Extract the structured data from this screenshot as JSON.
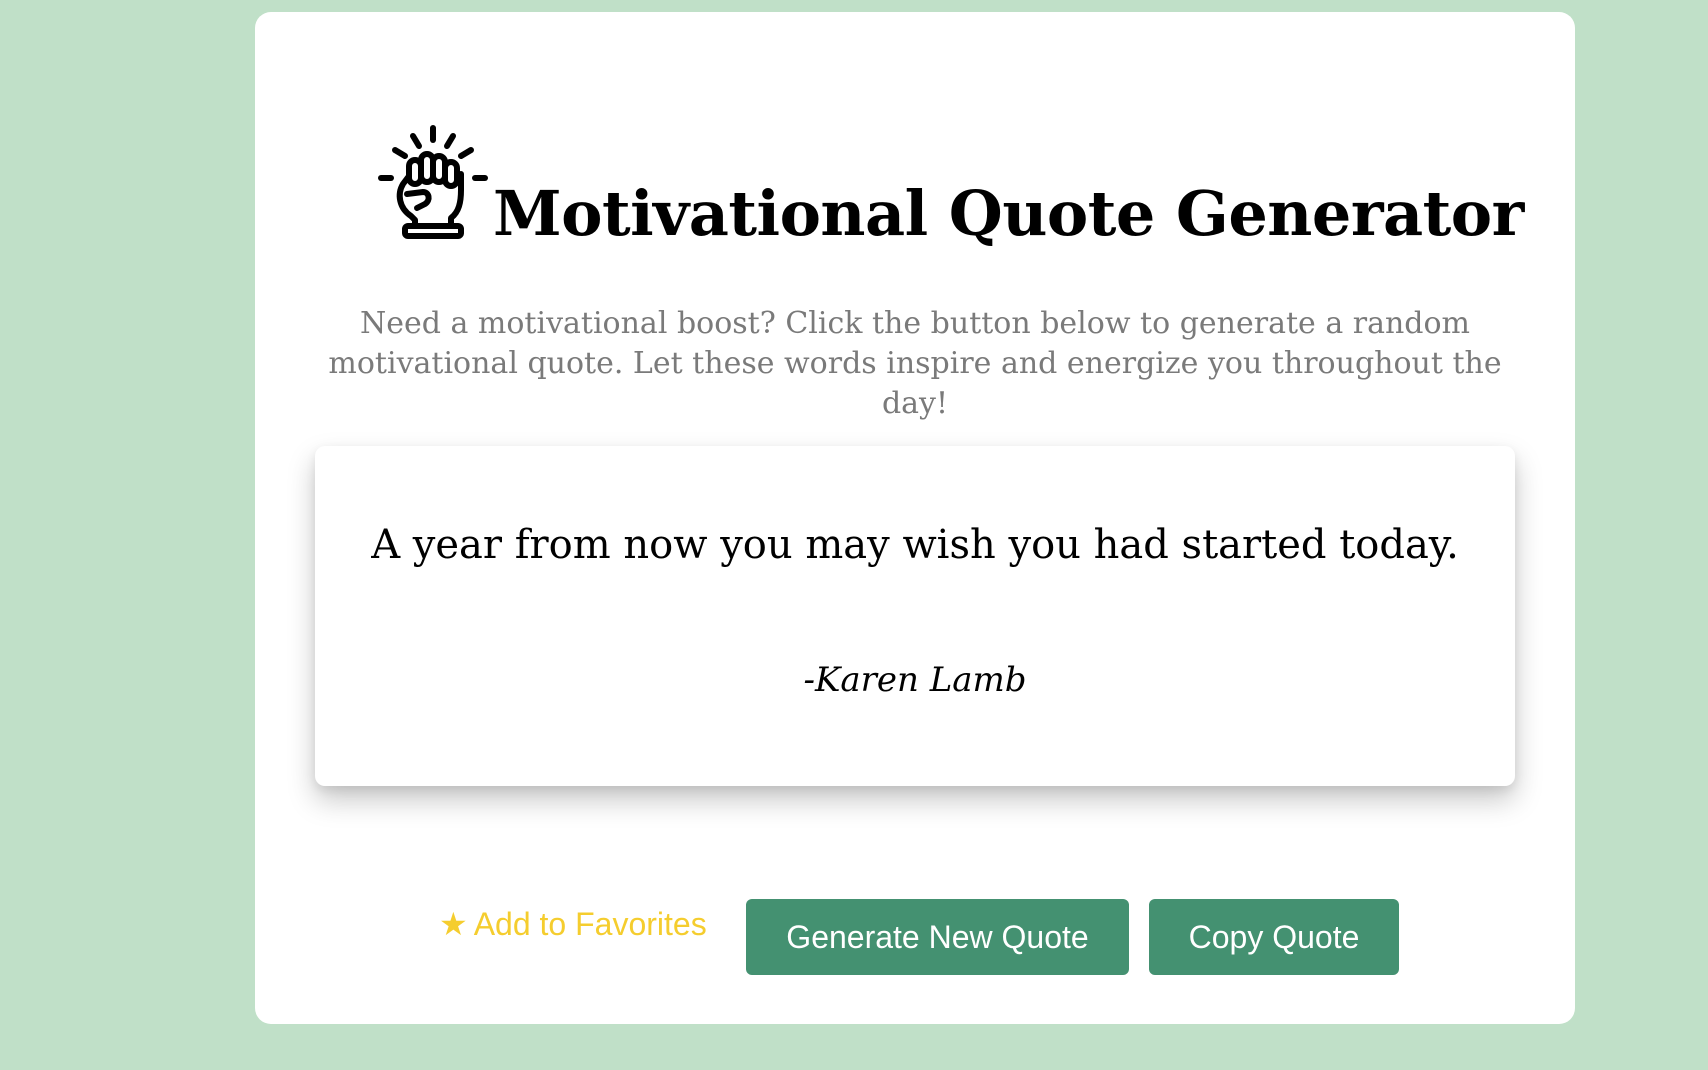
{
  "page": {
    "title": "Motivational Quote Generator",
    "description": "Need a motivational boost? Click the button below to generate a random motivational quote. Let these words inspire and energize you throughout the day!"
  },
  "quote": {
    "text": "A year from now you may wish you had started today.",
    "author": "-Karen Lamb"
  },
  "actions": {
    "favorite_icon": "★",
    "favorite_label": "Add to Favorites",
    "generate_label": "Generate New Quote",
    "copy_label": "Copy Quote"
  },
  "icons": {
    "title_icon": "raised-fist-icon",
    "favorite_icon": "star-icon"
  },
  "colors": {
    "background": "#c0e0c8",
    "card": "#ffffff",
    "button": "#449171",
    "favorite": "#f5cd2e",
    "description_text": "#7a7a7a"
  }
}
